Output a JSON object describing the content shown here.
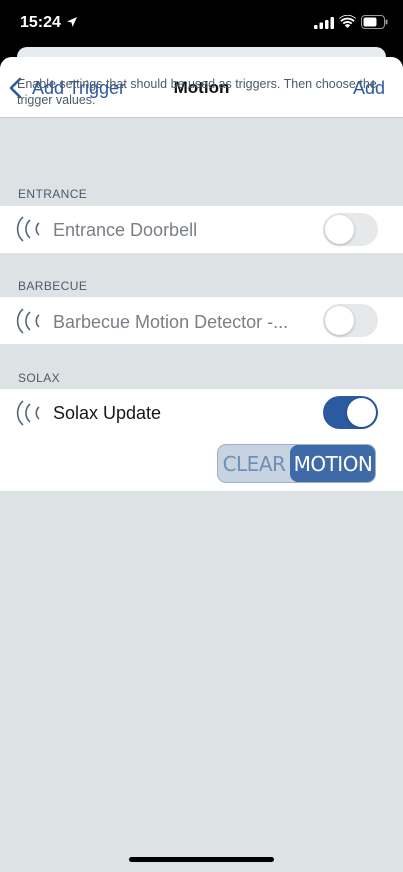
{
  "status_bar": {
    "time": "15:24",
    "icons": [
      "location-arrow-icon",
      "signal-icon",
      "wifi-icon",
      "battery-icon"
    ]
  },
  "navbar": {
    "back_label": "Add Trigger",
    "title": "Motion",
    "add_label": "Add"
  },
  "intro_text": "Enable settings that should be used as triggers. Then choose the trigger values.",
  "sections": [
    {
      "header": "ENTRANCE",
      "item": {
        "label": "Entrance Doorbell",
        "icon": "motion-wave-icon",
        "enabled": false
      }
    },
    {
      "header": "BARBECUE",
      "item": {
        "label": "Barbecue Motion Detector -...",
        "icon": "motion-wave-icon",
        "enabled": false
      }
    },
    {
      "header": "SOLAX",
      "item": {
        "label": "Solax Update",
        "icon": "motion-wave-icon",
        "enabled": true
      }
    }
  ],
  "trigger_value": {
    "options": [
      "CLEAR",
      "MOTION"
    ],
    "selected": "MOTION"
  },
  "colors": {
    "accent": "#2c5aa0",
    "background": "#dde2e5",
    "segment_selected": "#3f6aa8"
  }
}
